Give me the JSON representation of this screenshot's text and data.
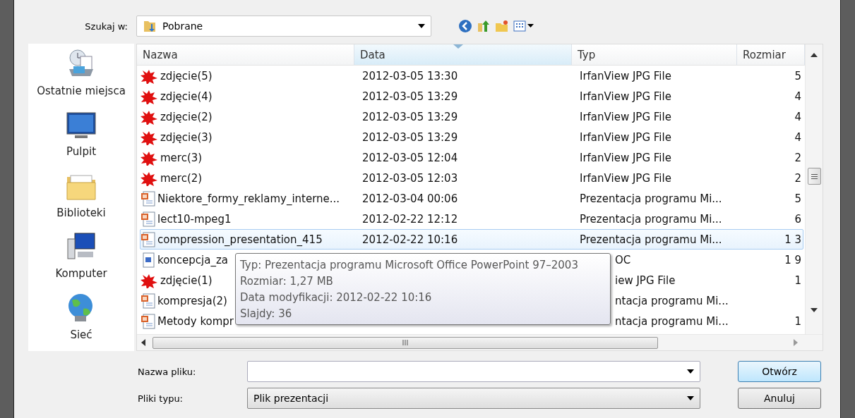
{
  "look_in": {
    "label": "Szukaj w:",
    "value": "Pobrane"
  },
  "places": [
    {
      "label": "Ostatnie miejsca",
      "kind": "recent"
    },
    {
      "label": "Pulpit",
      "kind": "desktop"
    },
    {
      "label": "Biblioteki",
      "kind": "libraries"
    },
    {
      "label": "Komputer",
      "kind": "computer"
    },
    {
      "label": "Sieć",
      "kind": "network"
    }
  ],
  "columns": [
    {
      "label": "Nazwa",
      "sorted": false
    },
    {
      "label": "Data",
      "sorted": true
    },
    {
      "label": "Typ",
      "sorted": false
    },
    {
      "label": "Rozmiar",
      "sorted": false
    }
  ],
  "rows": [
    {
      "kind": "jpg",
      "name": "zdjęcie(5)",
      "date": "2012-03-05 13:30",
      "type": "IrfanView JPG File",
      "size": "5",
      "selected": false,
      "covered": false
    },
    {
      "kind": "jpg",
      "name": "zdjęcie(4)",
      "date": "2012-03-05 13:29",
      "type": "IrfanView JPG File",
      "size": "4",
      "selected": false,
      "covered": false
    },
    {
      "kind": "jpg",
      "name": "zdjęcie(2)",
      "date": "2012-03-05 13:29",
      "type": "IrfanView JPG File",
      "size": "4",
      "selected": false,
      "covered": false
    },
    {
      "kind": "jpg",
      "name": "zdjęcie(3)",
      "date": "2012-03-05 13:29",
      "type": "IrfanView JPG File",
      "size": "4",
      "selected": false,
      "covered": false
    },
    {
      "kind": "jpg",
      "name": "merc(3)",
      "date": "2012-03-05 12:04",
      "type": "IrfanView JPG File",
      "size": "2",
      "selected": false,
      "covered": false
    },
    {
      "kind": "jpg",
      "name": "merc(2)",
      "date": "2012-03-05 12:03",
      "type": "IrfanView JPG File",
      "size": "2",
      "selected": false,
      "covered": false
    },
    {
      "kind": "ppt",
      "name": "Niektore_formy_reklamy_interne...",
      "date": "2012-03-04 00:06",
      "type": "Prezentacja programu Mi...",
      "size": "5",
      "selected": false,
      "covered": false
    },
    {
      "kind": "ppt",
      "name": "lect10-mpeg1",
      "date": "2012-02-22 12:12",
      "type": "Prezentacja programu Mi...",
      "size": "6",
      "selected": false,
      "covered": false
    },
    {
      "kind": "ppt",
      "name": "compression_presentation_415",
      "date": "2012-02-22 10:16",
      "type": "Prezentacja programu Mi...",
      "size": "1 3",
      "selected": true,
      "covered": false
    },
    {
      "kind": "doc",
      "name": "koncepcja_za",
      "type": "OC",
      "size": "1 9",
      "selected": false,
      "covered": true
    },
    {
      "kind": "jpg",
      "name": "zdjęcie(1)",
      "type": "iew JPG File",
      "size": "1",
      "selected": false,
      "covered": true
    },
    {
      "kind": "ppt",
      "name": "kompresja(2)",
      "type": "ntacja programu Mi...",
      "selected": false,
      "covered": true
    },
    {
      "kind": "ppt",
      "name": "Metody kompr",
      "type": "ntacja programu Mi...",
      "size": "1",
      "selected": false,
      "covered": true
    }
  ],
  "tooltip": [
    "Typ: Prezentacja programu Microsoft Office PowerPoint 97–2003",
    "Rozmiar: 1,27 MB",
    "Data modyfikacji: 2012-02-22 10:16",
    "Slajdy: 36"
  ],
  "hscroll_grip": "III",
  "file_name": {
    "label": "Nazwa pliku:"
  },
  "file_type": {
    "label": "Pliki typu:",
    "value": "Plik prezentacji"
  },
  "buttons": [
    {
      "label": "Otwórz",
      "default": true
    },
    {
      "label": "Anuluj",
      "default": false
    }
  ]
}
